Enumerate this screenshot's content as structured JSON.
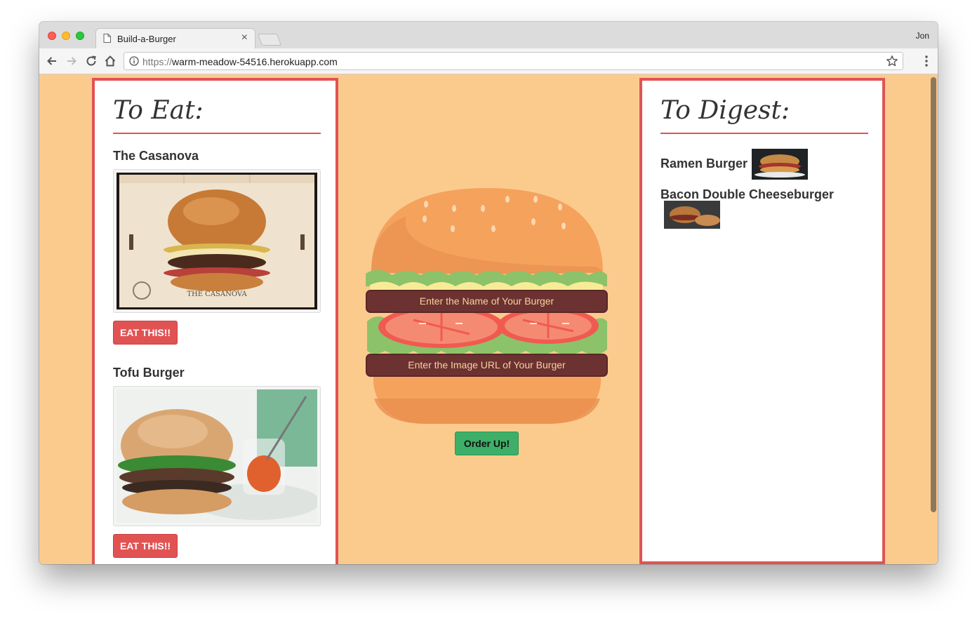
{
  "browser": {
    "tab_title": "Build-a-Burger",
    "tab_close": "×",
    "profile_name": "Jon",
    "url_scheme": "https://",
    "url_host": "warm-meadow-54516.herokuapp.com"
  },
  "to_eat": {
    "title": "To Eat:",
    "items": [
      {
        "name": "The Casanova",
        "button_label": "EAT THIS!!",
        "image_text": "THE CASANOVA"
      },
      {
        "name": "Tofu Burger",
        "button_label": "EAT THIS!!"
      }
    ]
  },
  "builder": {
    "name_placeholder": "Enter the Name of Your Burger",
    "url_placeholder": "Enter the Image URL of Your Burger",
    "order_label": "Order Up!"
  },
  "to_digest": {
    "title": "To Digest:",
    "items": [
      {
        "name": "Ramen Burger"
      },
      {
        "name": "Bacon Double Cheeseburger"
      }
    ]
  },
  "colors": {
    "page_bg": "#fbcb8e",
    "accent_red": "#e15353",
    "field_brown": "#6b3231",
    "order_green": "#3daf68"
  }
}
